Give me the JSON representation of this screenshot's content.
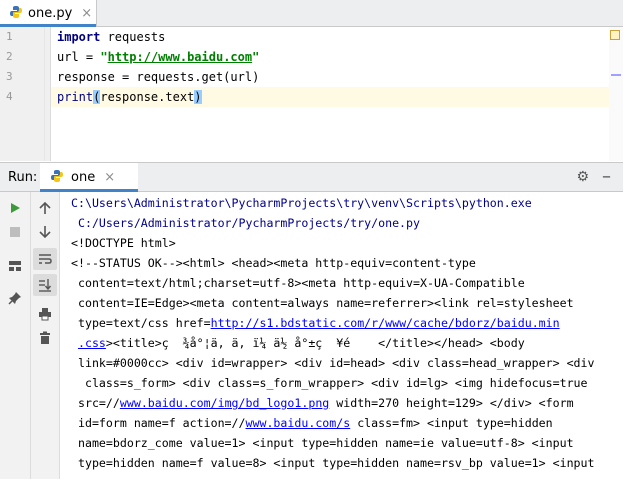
{
  "editor_tab": {
    "filename": "one.py"
  },
  "editor": {
    "line_numbers": [
      "1",
      "2",
      "3",
      "4"
    ],
    "lines": {
      "l1_kw": "import",
      "l1_rest": " requests",
      "l2_pre": "url = ",
      "l2_q1": "\"",
      "l2_url": "http://www.baidu.com",
      "l2_q2": "\"",
      "l3": "response = requests.get(url)",
      "l4_print": "print",
      "l4_open": "(",
      "l4_mid": "response.",
      "l4_text": "text",
      "l4_close": ")"
    }
  },
  "run_panel": {
    "label": "Run:",
    "tab_name": "one",
    "console": [
      {
        "parts": [
          {
            "t": "C:\\Users\\Administrator\\PycharmProjects\\try\\venv\\Scripts\\python.exe",
            "c": "cblue"
          }
        ]
      },
      {
        "parts": [
          {
            "t": " C:/Users/Administrator/PycharmProjects/try/one.py",
            "c": "cblue"
          }
        ]
      },
      {
        "parts": [
          {
            "t": "<!DOCTYPE html>"
          }
        ]
      },
      {
        "parts": [
          {
            "t": "<!--STATUS OK--><html> <head><meta http-equiv=content-type"
          }
        ]
      },
      {
        "parts": [
          {
            "t": " content=text/html;charset=utf-8><meta http-equiv=X-UA-Compatible"
          }
        ]
      },
      {
        "parts": [
          {
            "t": " content=IE=Edge><meta content=always name=referrer><link rel=stylesheet"
          }
        ]
      },
      {
        "parts": [
          {
            "t": " type=text/css href="
          },
          {
            "t": "http://s1.bdstatic.com/r/www/cache/bdorz/baidu.min",
            "c": "clink"
          }
        ]
      },
      {
        "parts": [
          {
            "t": " "
          },
          {
            "t": ".css",
            "c": "clink"
          },
          {
            "t": "><title>ç  ¾å°¦ä, ä, ï¼ ä½ å°±ç  ¥é    </title></head> <body"
          }
        ]
      },
      {
        "parts": [
          {
            "t": " link=#0000cc> <div id=wrapper> <div id=head> <div class=head_wrapper> <div"
          }
        ]
      },
      {
        "parts": [
          {
            "t": "  class=s_form> <div class=s_form_wrapper> <div id=lg> <img hidefocus=true"
          }
        ]
      },
      {
        "parts": [
          {
            "t": " src=//"
          },
          {
            "t": "www.baidu.com/img/bd_logo1.png",
            "c": "clink"
          },
          {
            "t": " width=270 height=129> </div> <form"
          }
        ]
      },
      {
        "parts": [
          {
            "t": " id=form name=f action=//"
          },
          {
            "t": "www.baidu.com/s",
            "c": "clink"
          },
          {
            "t": " class=fm> <input type=hidden"
          }
        ]
      },
      {
        "parts": [
          {
            "t": " name=bdorz_come value=1> <input type=hidden name=ie value=utf-8> <input"
          }
        ]
      },
      {
        "parts": [
          {
            "t": " type=hidden name=f value=8> <input type=hidden name=rsv_bp value=1> <input"
          }
        ]
      }
    ]
  },
  "colors": {
    "keyword": "#000080",
    "string": "#008000",
    "link": "#0000ff",
    "run_green": "#3c9a3c",
    "accent": "#4083c9"
  },
  "icons": {
    "left_toolbar": [
      "run-icon",
      "stop-icon",
      "layout-icon",
      "pin-icon"
    ],
    "right_toolbar": [
      "arrow-up-icon",
      "arrow-down-icon",
      "soft-wrap-icon",
      "scroll-to-end-icon",
      "print-icon",
      "trash-icon"
    ],
    "header": [
      "gear-icon",
      "minimize-icon"
    ]
  }
}
